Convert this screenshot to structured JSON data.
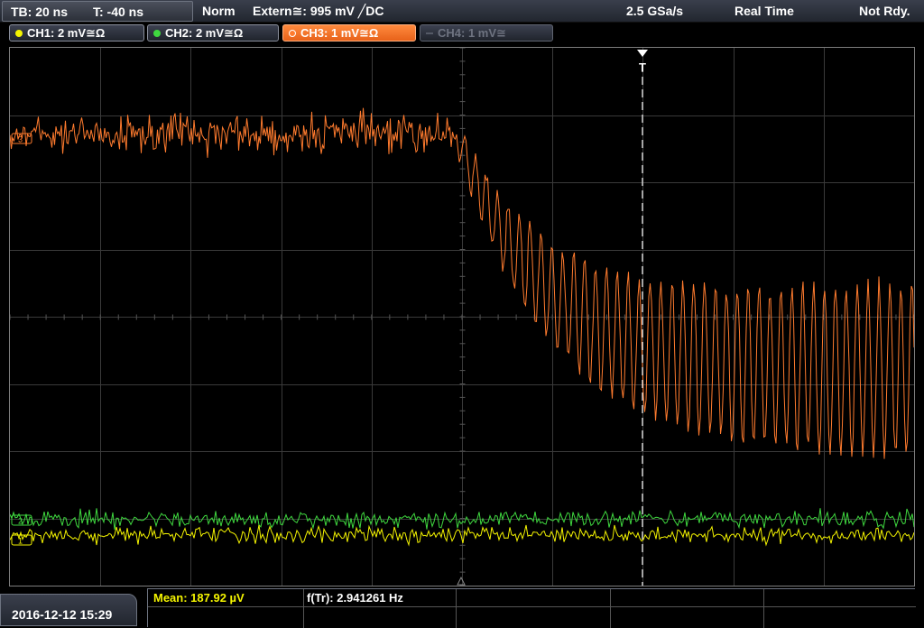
{
  "status": {
    "timebase": "TB: 20 ns",
    "trigger_time": "T: -40 ns",
    "trigger_mode": "Norm",
    "trigger_source": "Extern≅: 995 mV ╱DC",
    "sample_rate": "2.5 GSa/s",
    "acq_mode": "Real Time",
    "acq_state": "Not Rdy."
  },
  "channels": [
    {
      "label": "CH1: 2 mV≅Ω",
      "color": "#f4f400",
      "active": true
    },
    {
      "label": "CH2: 2 mV≅Ω",
      "color": "#3fd83f",
      "active": true
    },
    {
      "label": "CH3: 1 mV≅Ω",
      "color": "#ff7b2e",
      "active": true
    },
    {
      "label": "CH4: 1 mV≅",
      "color": "#6e7380",
      "active": false
    }
  ],
  "markers": {
    "ch3": "3",
    "ch2": "2",
    "ch1": "1",
    "trigger": "T"
  },
  "footer": {
    "datetime": "2016-12-12 15:29",
    "measurements": [
      {
        "label": "Mean: 187.92 µV",
        "color": "#f4f400"
      },
      {
        "label": "f(Tr): 2.941261 Hz",
        "color": "#ffffff"
      }
    ]
  },
  "colors": {
    "ch1": "#f4f400",
    "ch2": "#3fd83f",
    "ch3": "#ff7b2e",
    "grid": "#3a3a3a",
    "trigger_line": "#ffffff"
  }
}
